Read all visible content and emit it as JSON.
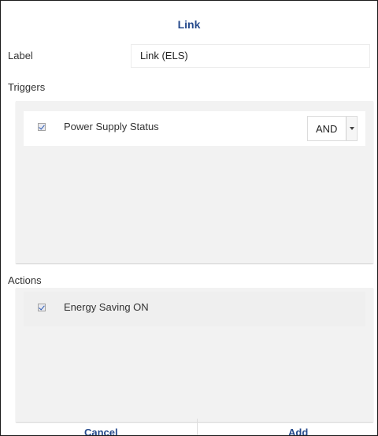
{
  "dialog": {
    "title": "Link"
  },
  "label_field": {
    "label": "Label",
    "value": "Link (ELS)"
  },
  "triggers": {
    "heading": "Triggers",
    "items": [
      {
        "label": "Power Supply Status",
        "checked": true,
        "operator": "AND"
      }
    ]
  },
  "actions": {
    "heading": "Actions",
    "items": [
      {
        "label": "Energy Saving ON",
        "checked": true
      }
    ]
  },
  "footer": {
    "cancel_label": "Cancel",
    "add_label": "Add"
  },
  "colors": {
    "accent": "#264a8c",
    "panel_bg": "#f2f2f2",
    "checkbox_tick": "#2a5bb5"
  }
}
